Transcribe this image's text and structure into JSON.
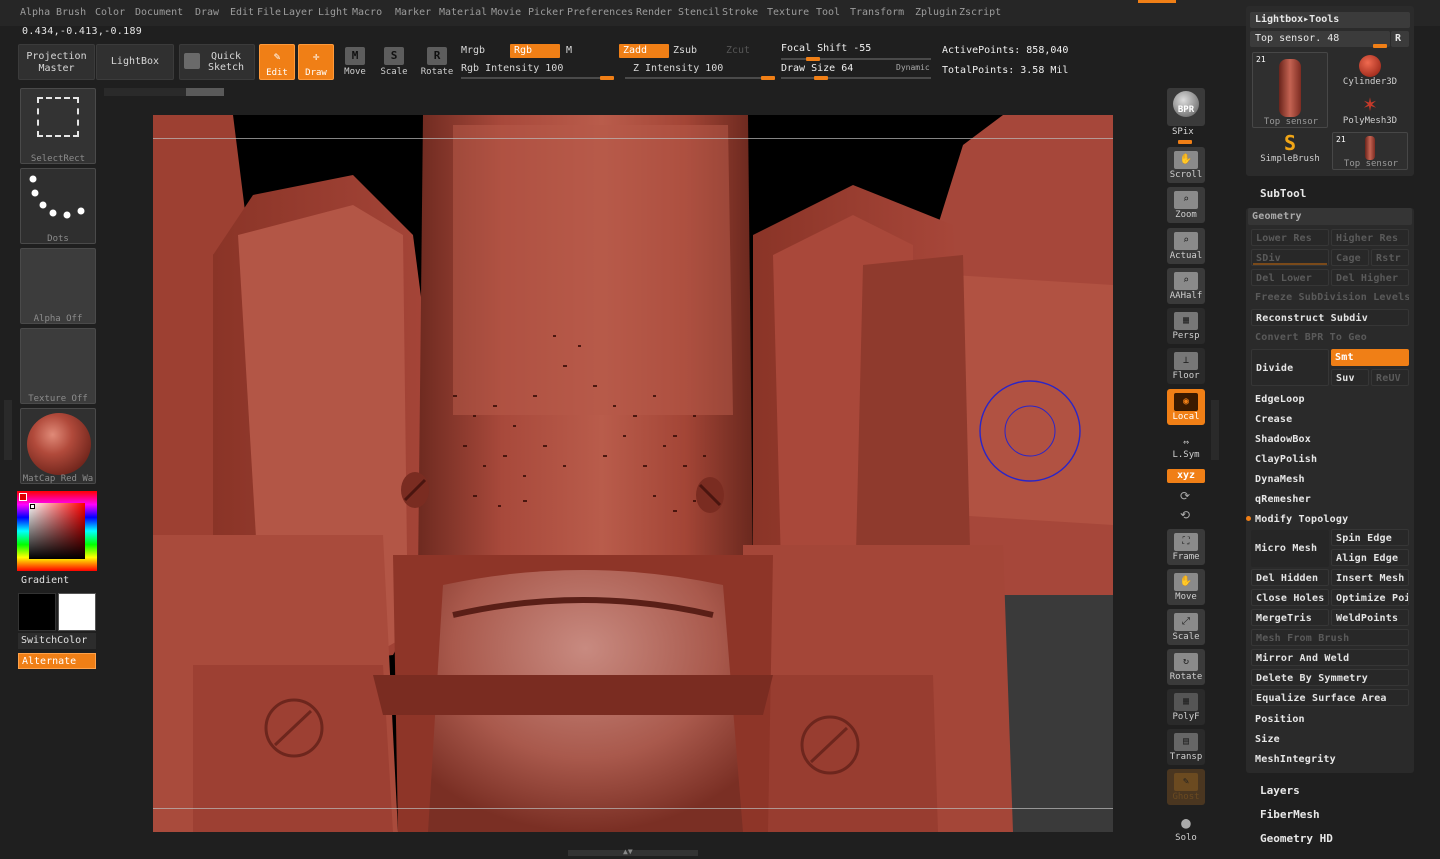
{
  "menubar": {
    "items": [
      "Alpha",
      "Brush",
      "Color",
      "Document",
      "Draw",
      "Edit",
      "File",
      "Layer",
      "Light",
      "Macro",
      "Marker",
      "Material",
      "Movie",
      "Picker",
      "Preferences",
      "Render",
      "Stencil",
      "Stroke",
      "Texture",
      "Tool",
      "Transform",
      "Zplugin",
      "Zscript"
    ]
  },
  "coordinates": "0.434,-0.413,-0.189",
  "toolbar": {
    "projection_master": [
      "Projection",
      "Master"
    ],
    "lightbox": "LightBox",
    "quick_sketch": [
      "Quick",
      "Sketch"
    ],
    "edit": "Edit",
    "draw": "Draw",
    "move": "Move",
    "scale": "Scale",
    "rotate": "Rotate",
    "mrgb": "Mrgb",
    "rgb": "Rgb",
    "m": "M",
    "rgb_intensity": "Rgb Intensity 100",
    "zadd": "Zadd",
    "zsub": "Zsub",
    "zcut": "Zcut",
    "z_intensity": "Z Intensity 100",
    "focal_shift": "Focal Shift -55",
    "draw_size": "Draw Size 64",
    "dynamic": "Dynamic",
    "active_points": "ActivePoints: 858,040",
    "total_points": "TotalPoints: 3.58 Mil",
    "glyphs": {
      "move": "M",
      "scale": "S",
      "rotate": "R"
    }
  },
  "left_panel": {
    "select_rect": "SelectRect",
    "dots": "Dots",
    "alpha_off": "Alpha Off",
    "texture_off": "Texture Off",
    "matcap": "MatCap Red Wa",
    "gradient": "Gradient",
    "switch_color": "SwitchColor",
    "alternate": "Alternate"
  },
  "right_dock": {
    "bpr": "BPR",
    "spix": "SPix",
    "scroll": "Scroll",
    "zoom": "Zoom",
    "actual": "Actual",
    "aahalf": "AAHalf",
    "persp": "Persp",
    "floor": "Floor",
    "local": "Local",
    "lsym": "L.Sym",
    "xyz": "xyz",
    "frame": "Frame",
    "move": "Move",
    "scale": "Scale",
    "rotate": "Rotate",
    "polyf": "PolyF",
    "transp": "Transp",
    "ghost": "Ghost",
    "solo": "Solo"
  },
  "right_panel": {
    "lightbox_tools": "Lightbox▸Tools",
    "top_sensor_slider": "Top sensor. 48",
    "r_button": "R",
    "tools": [
      {
        "label": "Top sensor",
        "count": "21"
      },
      {
        "label": "Cylinder3D"
      },
      {
        "label": "PolyMesh3D"
      },
      {
        "label": "SimpleBrush"
      },
      {
        "label": "Top sensor",
        "count": "21"
      }
    ],
    "subtool": "SubTool",
    "geometry": "Geometry",
    "lower_res": "Lower Res",
    "higher_res": "Higher Res",
    "sdiv": "SDiv",
    "cage": "Cage",
    "rstr": "Rstr",
    "del_lower": "Del Lower",
    "del_higher": "Del Higher",
    "freeze_subdiv": "Freeze SubDivision Levels",
    "reconstruct_subdiv": "Reconstruct Subdiv",
    "convert_bpr": "Convert BPR To Geo",
    "divide": "Divide",
    "smt": "Smt",
    "suv": "Suv",
    "reuv": "ReUV",
    "edgeloop": "EdgeLoop",
    "crease": "Crease",
    "shadowbox": "ShadowBox",
    "claypolish": "ClayPolish",
    "dynamesh": "DynaMesh",
    "qremesher": "qRemesher",
    "modify_topology": "Modify Topology",
    "micro_mesh": "Micro Mesh",
    "spin_edge": "Spin Edge",
    "align_edge": "Align Edge",
    "del_hidden": "Del Hidden",
    "insert_mesh": "Insert Mesh",
    "close_holes": "Close Holes",
    "optimize_points": "Optimize Poi",
    "mergetris": "MergeTris",
    "weldpoints": "WeldPoints",
    "mesh_from_brush": "Mesh From Brush",
    "mirror_and_weld": "Mirror And Weld",
    "delete_by_symmetry": "Delete By Symmetry",
    "equalize_surface_area": "Equalize Surface Area",
    "position": "Position",
    "size": "Size",
    "meshintegrity": "MeshIntegrity",
    "layers": "Layers",
    "fibermesh": "FiberMesh",
    "geometry_hd": "Geometry HD"
  },
  "colors": {
    "accent": "#f07f16",
    "model": "#a4463a",
    "background": "#1f1f1f",
    "brush_cursor": "#2a25c8"
  }
}
